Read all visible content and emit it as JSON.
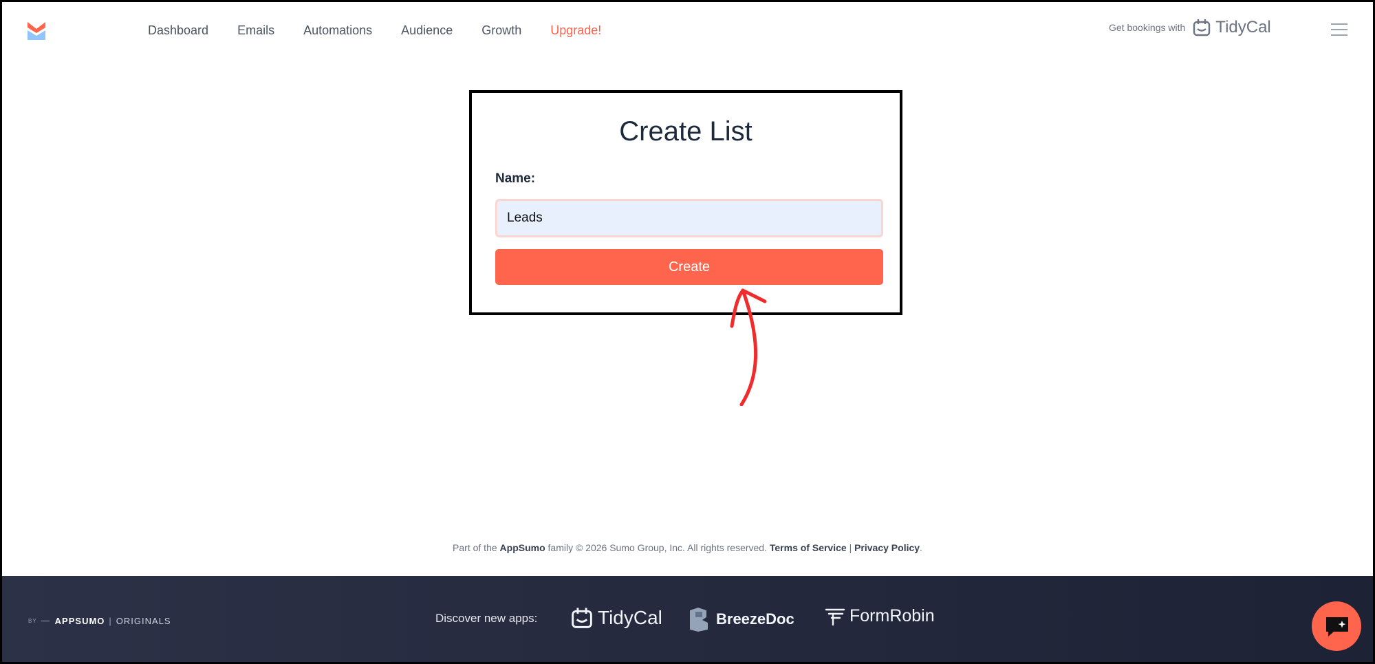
{
  "nav": {
    "items": [
      {
        "label": "Dashboard"
      },
      {
        "label": "Emails"
      },
      {
        "label": "Automations"
      },
      {
        "label": "Audience"
      },
      {
        "label": "Growth"
      },
      {
        "label": "Upgrade!"
      }
    ]
  },
  "promo": {
    "text": "Get bookings with",
    "brand": "TidyCal"
  },
  "form": {
    "title": "Create List",
    "name_label": "Name:",
    "name_value": "Leads",
    "submit_label": "Create"
  },
  "copyright": {
    "prefix": "Part of the",
    "brand": "AppSumo",
    "middle": "family © 2026 Sumo Group, Inc. All rights reserved.",
    "terms": "Terms of Service",
    "divider": "|",
    "privacy": "Privacy Policy",
    "suffix": "."
  },
  "footer": {
    "by_small": "BY",
    "by_brand": "APPSUMO",
    "by_sep": "|",
    "by_suffix": "ORIGINALS",
    "discover": "Discover new apps:",
    "apps": [
      {
        "name": "TidyCal"
      },
      {
        "name": "BreezeDoc"
      },
      {
        "name": "FormRobin"
      }
    ]
  },
  "colors": {
    "accent": "#ff644d",
    "footer_bg": "#262a3e",
    "input_bg": "#e8f0fe"
  }
}
